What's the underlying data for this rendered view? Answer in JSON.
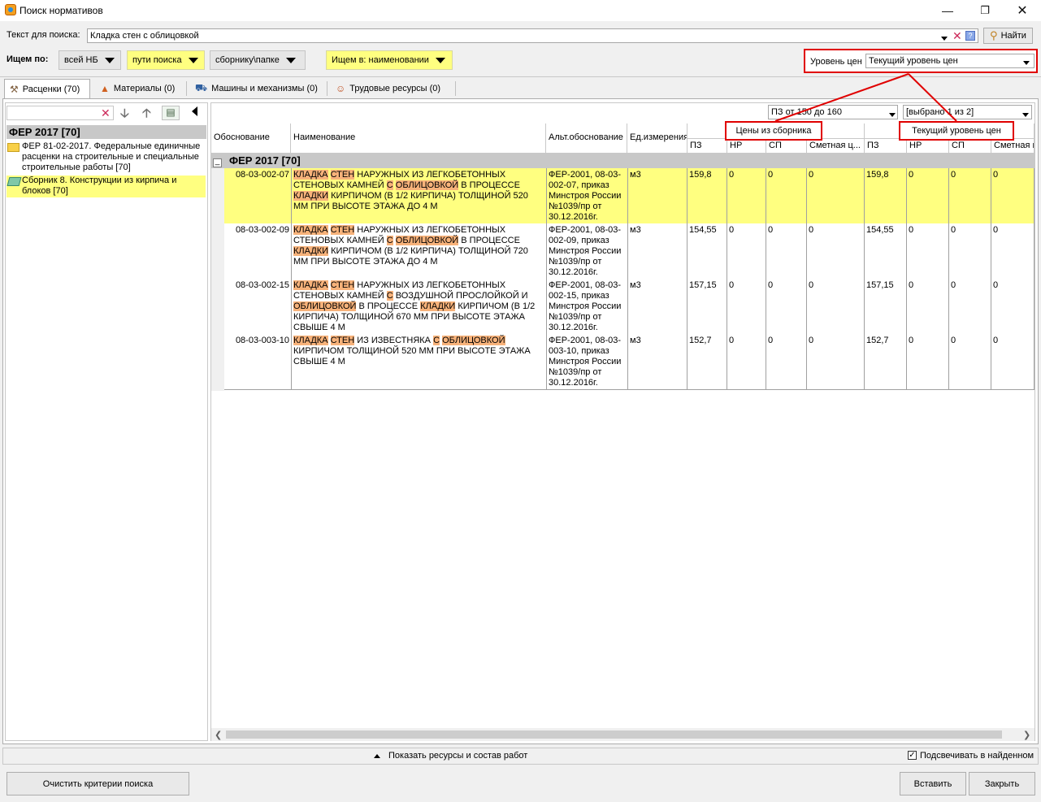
{
  "window": {
    "title": "Поиск нормативов"
  },
  "search": {
    "label": "Текст для поиска:",
    "value": "Кладка стен с облицовкой",
    "find_button": "Найти"
  },
  "filters": {
    "label": "Ищем по:",
    "scope": "всей НБ",
    "path": "пути поиска",
    "collection": "сборнику\\папке",
    "search_in": "Ищем в: наименовании",
    "price_level_label": "Уровень цен",
    "price_level_value": "Текущий уровень цен"
  },
  "tabs": [
    {
      "label": "Расценки (70)"
    },
    {
      "label": "Материалы (0)"
    },
    {
      "label": "Машины и механизмы (0)"
    },
    {
      "label": "Трудовые ресурсы (0)"
    }
  ],
  "tree": {
    "search_value": "",
    "header": "ФЕР 2017 [70]",
    "items": [
      {
        "label": "ФЕР 81-02-2017. Федеральные единичные расценки на строительные и специальные строительные работы [70]"
      },
      {
        "label": "Сборник 8. Конструкции из кирпича и блоков [70]"
      }
    ]
  },
  "grid": {
    "range_select": "ПЗ от 150 до 160",
    "selected_info": "[выбрано 1 из 2]",
    "group_collection": "Цены из сборника",
    "group_current": "Текущий уровень цен",
    "columns": [
      "Обоснование",
      "Наименование",
      "Альт.обоснование",
      "Ед.измерения",
      "ПЗ",
      "НР",
      "СП",
      "Сметная ц...",
      "ПЗ",
      "НР",
      "СП",
      "Сметная ц"
    ],
    "group_header": "ФЕР 2017 [70]",
    "rows": [
      {
        "code": "08-03-002-07",
        "name_parts": [
          [
            "КЛАДКА",
            true
          ],
          [
            " ",
            false
          ],
          [
            "СТЕН",
            true
          ],
          [
            " НАРУЖНЫХ ИЗ ЛЕГКОБЕТОННЫХ СТЕНОВЫХ КАМНЕЙ ",
            false
          ],
          [
            "С",
            true
          ],
          [
            " ",
            false
          ],
          [
            "ОБЛИЦОВКОЙ",
            true
          ],
          [
            " В ПРОЦЕССЕ ",
            false
          ],
          [
            "КЛАДКИ",
            true
          ],
          [
            " КИРПИЧОМ (В 1/2 КИРПИЧА) ТОЛЩИНОЙ 520 ММ ПРИ ВЫСОТЕ ЭТАЖА ДО 4 М",
            false
          ]
        ],
        "alt": "ФЕР-2001, 08-03-002-07, приказ Минстроя России №1039/пр от 30.12.2016г.",
        "unit": "м3",
        "pz": "159,8",
        "nr": "0",
        "sp": "0",
        "cost": "0",
        "pz2": "159,8",
        "nr2": "0",
        "sp2": "0",
        "cost2": "0"
      },
      {
        "code": "08-03-002-09",
        "name_parts": [
          [
            "КЛАДКА",
            true
          ],
          [
            " ",
            false
          ],
          [
            "СТЕН",
            true
          ],
          [
            " НАРУЖНЫХ ИЗ ЛЕГКОБЕТОННЫХ СТЕНОВЫХ КАМНЕЙ ",
            false
          ],
          [
            "С",
            true
          ],
          [
            " ",
            false
          ],
          [
            "ОБЛИЦОВКОЙ",
            true
          ],
          [
            " В ПРОЦЕССЕ ",
            false
          ],
          [
            "КЛАДКИ",
            true
          ],
          [
            " КИРПИЧОМ (В 1/2 КИРПИЧА) ТОЛЩИНОЙ 720 ММ ПРИ ВЫСОТЕ ЭТАЖА ДО 4 М",
            false
          ]
        ],
        "alt": "ФЕР-2001, 08-03-002-09, приказ Минстроя России №1039/пр от 30.12.2016г.",
        "unit": "м3",
        "pz": "154,55",
        "nr": "0",
        "sp": "0",
        "cost": "0",
        "pz2": "154,55",
        "nr2": "0",
        "sp2": "0",
        "cost2": "0"
      },
      {
        "code": "08-03-002-15",
        "name_parts": [
          [
            "КЛАДКА",
            true
          ],
          [
            " ",
            false
          ],
          [
            "СТЕН",
            true
          ],
          [
            " НАРУЖНЫХ ИЗ ЛЕГКОБЕТОННЫХ СТЕНОВЫХ КАМНЕЙ ",
            false
          ],
          [
            "С",
            true
          ],
          [
            " ВОЗДУШНОЙ ПРОСЛОЙКОЙ И ",
            false
          ],
          [
            "ОБЛИЦОВКОЙ",
            true
          ],
          [
            " В ПРОЦЕССЕ ",
            false
          ],
          [
            "КЛАДКИ",
            true
          ],
          [
            " КИРПИЧОМ (В 1/2 КИРПИЧА) ТОЛЩИНОЙ 670 ММ ПРИ ВЫСОТЕ ЭТАЖА СВЫШЕ 4 М",
            false
          ]
        ],
        "alt": "ФЕР-2001, 08-03-002-15, приказ Минстроя России №1039/пр от 30.12.2016г.",
        "unit": "м3",
        "pz": "157,15",
        "nr": "0",
        "sp": "0",
        "cost": "0",
        "pz2": "157,15",
        "nr2": "0",
        "sp2": "0",
        "cost2": "0"
      },
      {
        "code": "08-03-003-10",
        "name_parts": [
          [
            "КЛАДКА",
            true
          ],
          [
            " ",
            false
          ],
          [
            "СТЕН",
            true
          ],
          [
            " ИЗ ИЗВЕСТНЯКА ",
            false
          ],
          [
            "С",
            true
          ],
          [
            " ",
            false
          ],
          [
            "ОБЛИЦОВКОЙ",
            true
          ],
          [
            " КИРПИЧОМ ТОЛЩИНОЙ 520 ММ ПРИ ВЫСОТЕ ЭТАЖА СВЫШЕ 4 М",
            false
          ]
        ],
        "alt": "ФЕР-2001, 08-03-003-10, приказ Минстроя России №1039/пр от 30.12.2016г.",
        "unit": "м3",
        "pz": "152,7",
        "nr": "0",
        "sp": "0",
        "cost": "0",
        "pz2": "152,7",
        "nr2": "0",
        "sp2": "0",
        "cost2": "0"
      }
    ]
  },
  "bottom": {
    "show_resources": "Показать ресурсы и состав работ",
    "highlight_label": "Подсвечивать в найденном",
    "clear_button": "Очистить критерии поиска",
    "insert_button": "Вставить",
    "close_button": "Закрыть"
  }
}
